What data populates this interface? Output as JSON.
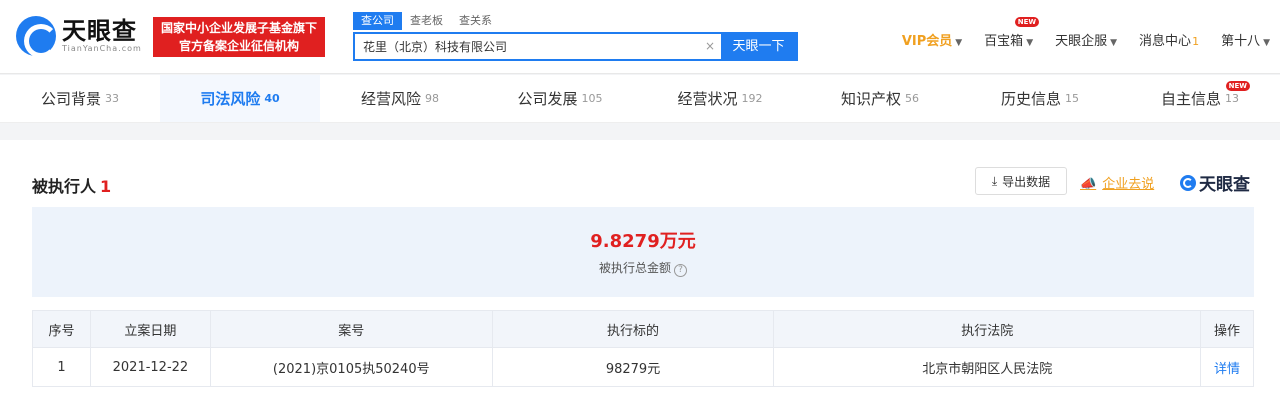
{
  "header": {
    "logo_text": "天眼查",
    "logo_sub": "TianYanCha.com",
    "banner_line1": "国家中小企业发展子基金旗下",
    "banner_line2": "官方备案企业征信机构",
    "search": {
      "tabs": [
        "查公司",
        "查老板",
        "查关系"
      ],
      "value": "花里（北京）科技有限公司",
      "clear_icon": "×",
      "button": "天眼一下"
    },
    "nav": {
      "vip": "VIP会员",
      "baibaoxiang": "百宝箱",
      "new_badge": "NEW",
      "tianyanqiguan": "天眼企服",
      "messages": "消息中心",
      "messages_count": "1",
      "user": "第十八"
    }
  },
  "tabs": [
    {
      "label": "公司背景",
      "count": "33"
    },
    {
      "label": "司法风险",
      "count": "40"
    },
    {
      "label": "经营风险",
      "count": "98"
    },
    {
      "label": "公司发展",
      "count": "105"
    },
    {
      "label": "经营状况",
      "count": "192"
    },
    {
      "label": "知识产权",
      "count": "56"
    },
    {
      "label": "历史信息",
      "count": "15"
    },
    {
      "label": "自主信息",
      "count": "13",
      "badge": "NEW"
    }
  ],
  "section": {
    "title": "被执行人",
    "count": "1",
    "export_label": "导出数据",
    "report_label": "企业去说",
    "brand": "天眼查"
  },
  "summary": {
    "amount": "9.8279万元",
    "label": "被执行总金额",
    "help_icon": "?"
  },
  "table": {
    "headers": [
      "序号",
      "立案日期",
      "案号",
      "执行标的",
      "执行法院",
      "操作"
    ],
    "rows": [
      {
        "index": "1",
        "date": "2021-12-22",
        "case_no": "(2021)京0105执50240号",
        "amount": "98279元",
        "court": "北京市朝阳区人民法院",
        "action": "详情"
      }
    ]
  }
}
